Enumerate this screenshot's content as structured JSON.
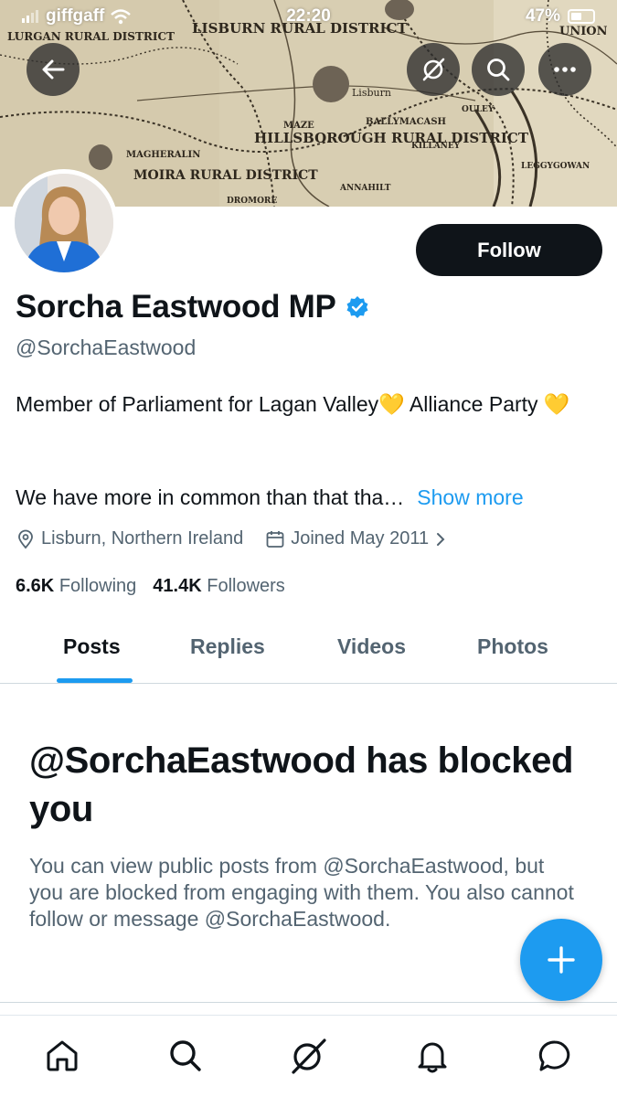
{
  "status_bar": {
    "carrier": "giffgaff",
    "time": "22:20",
    "battery": "47%"
  },
  "banner": {
    "map_labels": [
      "LISBURN RURAL DISTRICT",
      "HILLSBOROUGH RURAL DISTRICT",
      "MOIRA RURAL DISTRICT",
      "LURGAN RURAL DISTRICT",
      "Lisburn",
      "MAZE",
      "MAGHERALIN",
      "BALLYMACASH",
      "ANNAHILT",
      "DROMORE",
      "LEGGYGOWAN",
      "OULEY",
      "KILLANEY",
      "UNION"
    ]
  },
  "profile": {
    "display_name": "Sorcha Eastwood MP",
    "handle": "@SorchaEastwood",
    "follow_label": "Follow",
    "bio_line1": "Member of Parliament for Lagan Valley💛 Alliance Party 💛",
    "bio_line2": "We have more in common than that tha…",
    "show_more": "Show more",
    "location": "Lisburn, Northern Ireland",
    "joined": "Joined May 2011",
    "following_count": "6.6K",
    "following_label": "Following",
    "followers_count": "41.4K",
    "followers_label": "Followers"
  },
  "tabs": [
    {
      "label": "Posts",
      "active": true
    },
    {
      "label": "Replies",
      "active": false
    },
    {
      "label": "Videos",
      "active": false
    },
    {
      "label": "Photos",
      "active": false
    }
  ],
  "blocked": {
    "title": "@SorchaEastwood has blocked you",
    "body": "You can view public posts from @SorchaEastwood, but you are blocked from engaging with them. You also cannot follow or message @SorchaEastwood."
  },
  "colors": {
    "accent": "#1d9bf0",
    "text_primary": "#0f1419",
    "text_secondary": "#536471",
    "follow_button_bg": "#0f1419",
    "verified_badge": "#1d9bf0"
  },
  "icons": {
    "top_bar": [
      "back-arrow-icon",
      "grok-icon",
      "search-icon",
      "more-icon"
    ],
    "bottom_nav": [
      "home-icon",
      "search-icon",
      "grok-icon",
      "notifications-icon",
      "messages-icon"
    ],
    "fab": "plus-icon"
  }
}
